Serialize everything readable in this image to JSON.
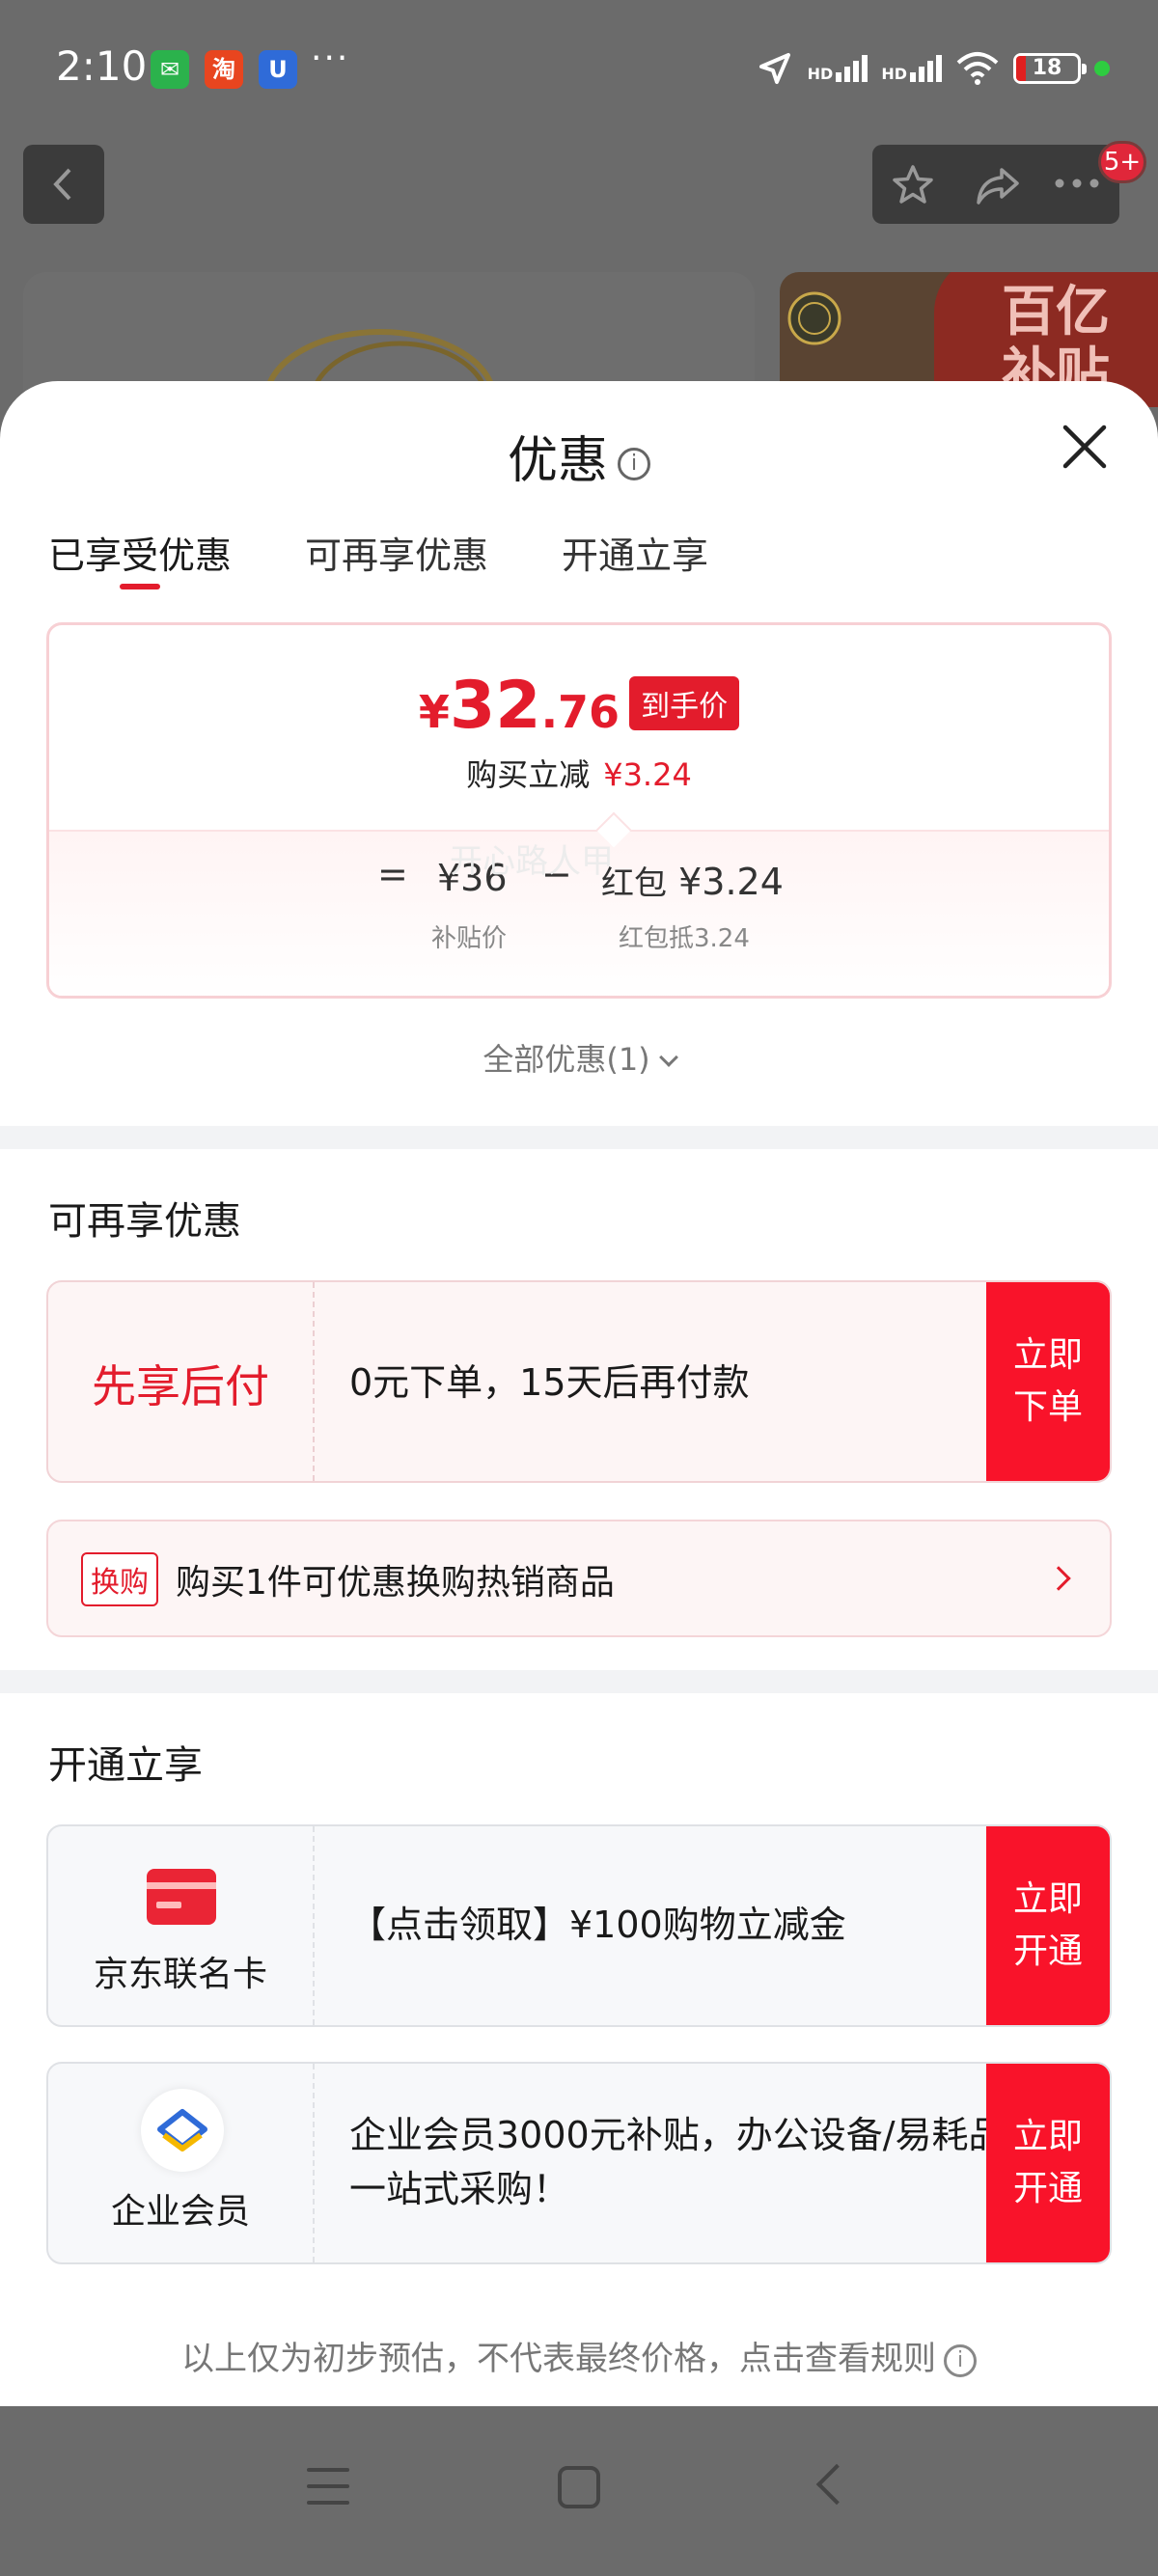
{
  "status_bar": {
    "time": "2:10",
    "apps": [
      "wechat-icon",
      "taobao-icon",
      "u-app-icon"
    ],
    "more": "···",
    "network": [
      "HD",
      "HD"
    ],
    "battery": "18"
  },
  "sheet": {
    "title": "优惠",
    "tabs": [
      {
        "label": "已享受优惠",
        "active": true
      },
      {
        "label": "可再享优惠",
        "active": false
      },
      {
        "label": "开通立享",
        "active": false
      }
    ]
  },
  "price_card": {
    "currency": "¥",
    "price_int": "32",
    "price_dec": ".76",
    "price_tag": "到手价",
    "reduce_label": "购买立减",
    "reduce_amount": "¥3.24",
    "equals": "=",
    "base_price": "¥36",
    "base_label": "补贴价",
    "minus": "−",
    "coupon_prefix": "红包",
    "coupon_amount": "¥3.24",
    "coupon_label": "红包抵3.24"
  },
  "all_offers": "全部优惠(1)",
  "more_offers": {
    "title": "可再享优惠",
    "watermark": "开心路人甲",
    "pay_later": {
      "left_title": "先享后付",
      "text": "0元下单，15天后再付款",
      "button_line1": "立即",
      "button_line2": "下单"
    },
    "swap": {
      "tag": "换购",
      "text": "购买1件可优惠换购热销商品"
    }
  },
  "open_now": {
    "title": "开通立享",
    "items": [
      {
        "label": "京东联名卡",
        "text": "【点击领取】¥100购物立减金",
        "button_line1": "立即",
        "button_line2": "开通"
      },
      {
        "label": "企业会员",
        "text": "企业会员3000元补贴，办公设备/易耗品一站式采购！",
        "button_line1": "立即",
        "button_line2": "开通"
      }
    ]
  },
  "disclaimer": "以上仅为初步预估，不代表最终价格，点击查看规则",
  "background": {
    "badge": "5+",
    "promo_text": "百亿补贴"
  },
  "colors": {
    "accent": "#e31c2c",
    "button_red": "#f9132a"
  }
}
